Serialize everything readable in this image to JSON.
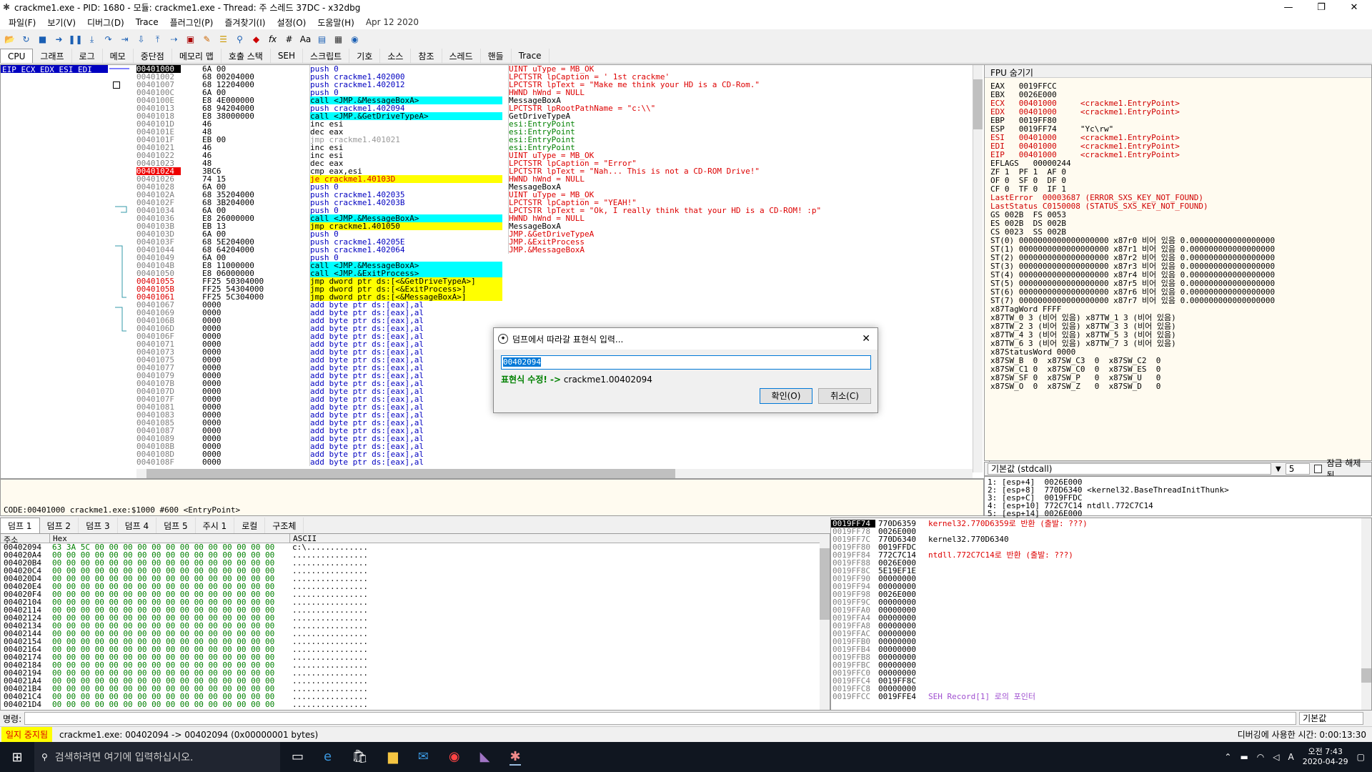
{
  "window": {
    "title": "crackme1.exe - PID: 1680 - 모듈: crackme1.exe - Thread: 주 스레드 37DC - x32dbg"
  },
  "menu": {
    "items": [
      "파일(F)",
      "보기(V)",
      "디버그(D)",
      "Trace",
      "플러그인(P)",
      "즐겨찾기(I)",
      "설정(O)",
      "도움말(H)",
      "Apr 12 2020"
    ]
  },
  "tabs": [
    "CPU",
    "그래프",
    "로그",
    "메모",
    "중단점",
    "메모리 맵",
    "호출 스택",
    "SEH",
    "스크립트",
    "기호",
    "소스",
    "참조",
    "스레드",
    "핸들",
    "Trace"
  ],
  "cpu": {
    "reg_labels": "EIP ECX EDX ESI EDI",
    "addresses": [
      "00401000",
      "00401002",
      "00401007",
      "0040100C",
      "0040100E",
      "00401013",
      "00401018",
      "0040101D",
      "0040101E",
      "0040101F",
      "00401021",
      "00401022",
      "00401023",
      "00401024",
      "00401026",
      "00401028",
      "0040102A",
      "0040102F",
      "00401034",
      "00401036",
      "0040103B",
      "0040103D",
      "0040103F",
      "00401044",
      "00401049",
      "0040104B",
      "00401050",
      "00401055",
      "0040105B",
      "00401061",
      "00401067",
      "00401069",
      "0040106B",
      "0040106D",
      "0040106F",
      "00401071",
      "00401073",
      "00401075",
      "00401077",
      "00401079",
      "0040107B",
      "0040107D",
      "0040107F",
      "00401081",
      "00401083",
      "00401085",
      "00401087",
      "00401089",
      "0040108B",
      "0040108D",
      "0040108F"
    ],
    "bytes": [
      "6A 00",
      "68 00204000",
      "68 12204000",
      "6A 00",
      "E8 4E000000",
      "68 94204000",
      "E8 38000000",
      "46",
      "48",
      "EB 00",
      "46",
      "46",
      "48",
      "3BC6",
      "74 15",
      "6A 00",
      "68 35204000",
      "68 3B204000",
      "6A 00",
      "E8 26000000",
      "EB 13",
      "6A 00",
      "68 5E204000",
      "68 64204000",
      "6A 00",
      "E8 11000000",
      "E8 06000000",
      "FF25 50304000",
      "FF25 54304000",
      "FF25 5C304000",
      "0000",
      "0000",
      "0000",
      "0000",
      "0000",
      "0000",
      "0000",
      "0000",
      "0000",
      "0000",
      "0000",
      "0000",
      "0000",
      "0000",
      "0000",
      "0000",
      "0000",
      "0000",
      "0000",
      "0000",
      "0000"
    ],
    "instr": [
      "push 0",
      "push crackme1.402000",
      "push crackme1.402012",
      "push 0",
      "call <JMP.&MessageBoxA>",
      "push crackme1.402094",
      "call <JMP.&GetDriveTypeA>",
      "inc esi",
      "dec eax",
      "jmp crackme1.401021",
      "inc esi",
      "inc esi",
      "dec eax",
      "cmp eax,esi",
      "je crackme1.40103D",
      "push 0",
      "push crackme1.402035",
      "push crackme1.40203B",
      "push 0",
      "call <JMP.&MessageBoxA>",
      "jmp crackme1.401050",
      "push 0",
      "push crackme1.40205E",
      "push crackme1.402064",
      "push 0",
      "call <JMP.&MessageBoxA>",
      "call <JMP.&ExitProcess>",
      "jmp dword ptr ds:[<&GetDriveTypeA>]",
      "jmp dword ptr ds:[<&ExitProcess>]",
      "jmp dword ptr ds:[<&MessageBoxA>]",
      "add byte ptr ds:[eax],al",
      "add byte ptr ds:[eax],al",
      "add byte ptr ds:[eax],al",
      "add byte ptr ds:[eax],al",
      "add byte ptr ds:[eax],al",
      "add byte ptr ds:[eax],al",
      "add byte ptr ds:[eax],al",
      "add byte ptr ds:[eax],al",
      "add byte ptr ds:[eax],al",
      "add byte ptr ds:[eax],al",
      "add byte ptr ds:[eax],al",
      "add byte ptr ds:[eax],al",
      "add byte ptr ds:[eax],al",
      "add byte ptr ds:[eax],al",
      "add byte ptr ds:[eax],al",
      "add byte ptr ds:[eax],al",
      "add byte ptr ds:[eax],al",
      "add byte ptr ds:[eax],al",
      "add byte ptr ds:[eax],al",
      "add byte ptr ds:[eax],al",
      "add byte ptr ds:[eax],al"
    ],
    "comments": [
      "UINT uType = MB_OK",
      "LPCTSTR lpCaption = ' 1st crackme'",
      "LPCTSTR lpText = \"Make me think your HD is a CD-Rom.\"",
      "HWND hWnd = NULL",
      "MessageBoxA",
      "LPCTSTR lpRootPathName = \"c:\\\\\"",
      "GetDriveTypeA",
      "esi:EntryPoint",
      "",
      "",
      "esi:EntryPoint",
      "esi:EntryPoint",
      "",
      "esi:EntryPoint",
      "",
      "UINT uType = MB_OK",
      "LPCTSTR lpCaption = \"Error\"",
      "LPCTSTR lpText = \"Nah... This is not a CD-ROM Drive!\"",
      "HWND hWnd = NULL",
      "MessageBoxA",
      "",
      "UINT uType = MB_OK",
      "LPCTSTR lpCaption = \"YEAH!\"",
      "LPCTSTR lpText = \"Ok, I really think that your HD is a CD-ROM! :p\"",
      "HWND hWnd = NULL",
      "MessageBoxA",
      "",
      "JMP.&GetDriveTypeA",
      "JMP.&ExitProcess",
      "JMP.&MessageBoxA"
    ]
  },
  "fpu": {
    "header": "FPU 숨기기",
    "lines": [
      "EAX   0019FFCC",
      "EBX   0026E000",
      "ECX   00401000     <crackme1.EntryPoint>",
      "EDX   00401000     <crackme1.EntryPoint>",
      "EBP   0019FF80",
      "ESP   0019FF74     \"Yc\\rw\"",
      "ESI   00401000     <crackme1.EntryPoint>",
      "EDI   00401000     <crackme1.EntryPoint>",
      "",
      "EIP   00401000     <crackme1.EntryPoint>",
      "",
      "EFLAGS   00000244",
      "ZF 1  PF 1  AF 0",
      "OF 0  SF 0  DF 0",
      "CF 0  TF 0  IF 1",
      "",
      "LastError  00003687 (ERROR_SXS_KEY_NOT_FOUND)",
      "LastStatus C0150008 (STATUS_SXS_KEY_NOT_FOUND)",
      "",
      "GS 002B  FS 0053",
      "ES 002B  DS 002B",
      "CS 0023  SS 002B",
      "",
      "ST(0) 0000000000000000000 x87r0 비어 있음 0.000000000000000000",
      "ST(1) 0000000000000000000 x87r1 비어 있음 0.000000000000000000",
      "ST(2) 0000000000000000000 x87r2 비어 있음 0.000000000000000000",
      "ST(3) 0000000000000000000 x87r3 비어 있음 0.000000000000000000",
      "ST(4) 0000000000000000000 x87r4 비어 있음 0.000000000000000000",
      "ST(5) 0000000000000000000 x87r5 비어 있음 0.000000000000000000",
      "ST(6) 0000000000000000000 x87r6 비어 있음 0.000000000000000000",
      "ST(7) 0000000000000000000 x87r7 비어 있음 0.000000000000000000",
      "",
      "x87TagWord FFFF",
      "x87TW_0 3 (비어 있음) x87TW_1 3 (비어 있음)",
      "x87TW_2 3 (비어 있음) x87TW_3 3 (비어 있음)",
      "x87TW_4 3 (비어 있음) x87TW_5 3 (비어 있음)",
      "x87TW_6 3 (비어 있음) x87TW_7 3 (비어 있음)",
      "",
      "x87StatusWord 0000",
      "x87SW_B  0  x87SW_C3  0  x87SW_C2  0",
      "x87SW_C1 0  x87SW_C0  0  x87SW_ES  0",
      "x87SW_SF 0  x87SW_P   0  x87SW_U   0",
      "x87SW_O  0  x87SW_Z   0  x87SW_D   0"
    ]
  },
  "callconv": {
    "label": "기본값 (stdcall)",
    "count": "5",
    "unlock": "잠금 해제됨"
  },
  "callstack": [
    "1: [esp+4]  0026E000",
    "2: [esp+8]  770D6340 <kernel32.BaseThreadInitThunk>",
    "3: [esp+C]  0019FFDC",
    "4: [esp+10] 772C7C14 ntdll.772C7C14",
    "5: [esp+14] 0026E000"
  ],
  "info": "CODE:00401000 crackme1.exe:$1000 #600 <EntryPoint>",
  "dumptabs": [
    "덤프 1",
    "덤프 2",
    "덤프 3",
    "덤프 4",
    "덤프 5",
    "주시 1",
    "로컬",
    "구조체"
  ],
  "dump": {
    "headers": [
      "주소",
      "Hex",
      "ASCII"
    ],
    "addresses": [
      "00402094",
      "004020A4",
      "004020B4",
      "004020C4",
      "004020D4",
      "004020E4",
      "004020F4",
      "00402104",
      "00402114",
      "00402124",
      "00402134",
      "00402144",
      "00402154",
      "00402164",
      "00402174",
      "00402184",
      "00402194",
      "004021A4",
      "004021B4",
      "004021C4",
      "004021D4"
    ],
    "first_hex": "63 3A 5C 00 00 00 00 00 00 00 00 00 00 00 00 00",
    "other_hex": "00 00 00 00 00 00 00 00 00 00 00 00 00 00 00 00",
    "first_ascii": "c:\\.............",
    "other_ascii": "................"
  },
  "stack": {
    "addresses": [
      "0019FF74",
      "0019FF78",
      "0019FF7C",
      "0019FF80",
      "0019FF84",
      "0019FF88",
      "0019FF8C",
      "0019FF90",
      "0019FF94",
      "0019FF98",
      "0019FF9C",
      "0019FFA0",
      "0019FFA4",
      "0019FFA8",
      "0019FFAC",
      "0019FFB0",
      "0019FFB4",
      "0019FFB8",
      "0019FFBC",
      "0019FFC0",
      "0019FFC4",
      "0019FFC8",
      "0019FFCC"
    ],
    "values": [
      "770D6359",
      "0026E000",
      "770D6340",
      "0019FFDC",
      "772C7C14",
      "0026E000",
      "5E19EF1E",
      "00000000",
      "00000000",
      "0026E000",
      "00000000",
      "00000000",
      "00000000",
      "00000000",
      "00000000",
      "00000000",
      "00000000",
      "00000000",
      "00000000",
      "00000000",
      "0019FF8C",
      "00000000",
      "0019FFE4"
    ],
    "comments": [
      "kernel32.770D6359로 반환 (출발: ???)",
      "",
      "kernel32.770D6340",
      "",
      "ntdll.772C7C14로 반환 (출발: ???)",
      "",
      "",
      "",
      "",
      "",
      "",
      "",
      "",
      "",
      "",
      "",
      "",
      "",
      "",
      "",
      "",
      "",
      "SEH Record[1] 로의 포인터"
    ]
  },
  "cmd": {
    "label": "명령:",
    "right": "기본값"
  },
  "status": {
    "state": "일지 중지됨",
    "msg": "crackme1.exe: 00402094 -> 00402094 (0x00000001 bytes)",
    "time": "디버깅에 사용한 시간: 0:00:13:30"
  },
  "dialog": {
    "title": "덤프에서 따라갈 표현식 입력...",
    "value": "00402094",
    "hint_label": "표현식 수정! ->",
    "hint_value": "crackme1.00402094",
    "ok": "확인(O)",
    "cancel": "취소(C)"
  },
  "taskbar": {
    "search": "검색하려면 여기에 입력하십시오.",
    "time": "오전 7:43",
    "date": "2020-04-29",
    "lang": "A"
  }
}
